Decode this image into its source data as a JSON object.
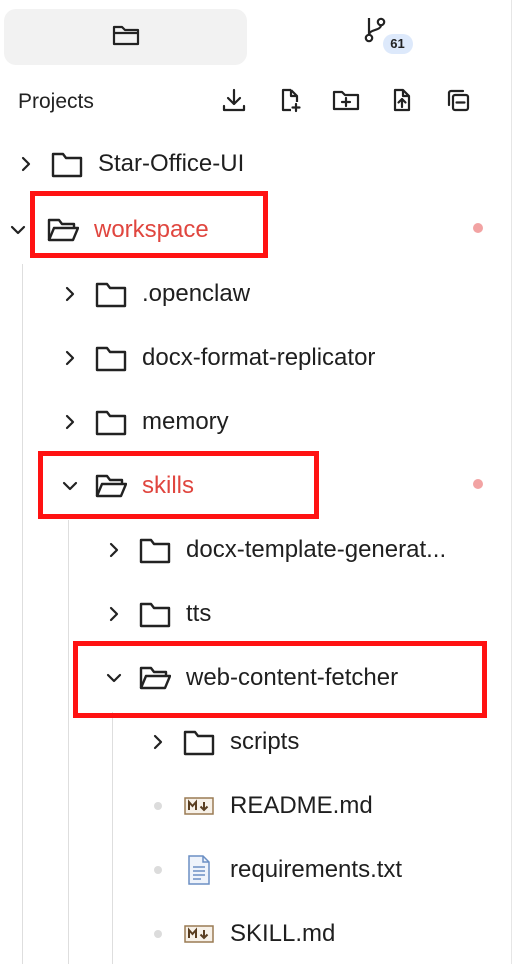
{
  "tabs": {
    "files": {
      "icon": "folder-icon",
      "active": true
    },
    "git": {
      "icon": "git-branch-icon",
      "badge": "61"
    }
  },
  "toolbar": {
    "title": "Projects",
    "actions": [
      "download-icon",
      "new-file-icon",
      "new-folder-icon",
      "upload-icon",
      "collapse-all-icon"
    ]
  },
  "tree": {
    "star_office": {
      "label": "Star-Office-UI"
    },
    "workspace": {
      "label": "workspace",
      "modified": true
    },
    "openclaw": {
      "label": ".openclaw"
    },
    "docx_format": {
      "label": "docx-format-replicator"
    },
    "memory": {
      "label": "memory"
    },
    "skills": {
      "label": "skills",
      "modified": true
    },
    "docx_template": {
      "label": "docx-template-generat..."
    },
    "tts": {
      "label": "tts"
    },
    "web_fetcher": {
      "label": "web-content-fetcher"
    },
    "scripts": {
      "label": "scripts"
    },
    "readme": {
      "label": "README.md",
      "icon": "markdown-icon"
    },
    "requirements": {
      "label": "requirements.txt",
      "icon": "text-file-icon"
    },
    "skill_md": {
      "label": "SKILL.md",
      "icon": "markdown-icon"
    }
  },
  "colors": {
    "modified": "#e0463f",
    "modified_dot": "#f2a3a3",
    "highlight": "#ff1212",
    "badge_bg": "#dde9fb"
  }
}
